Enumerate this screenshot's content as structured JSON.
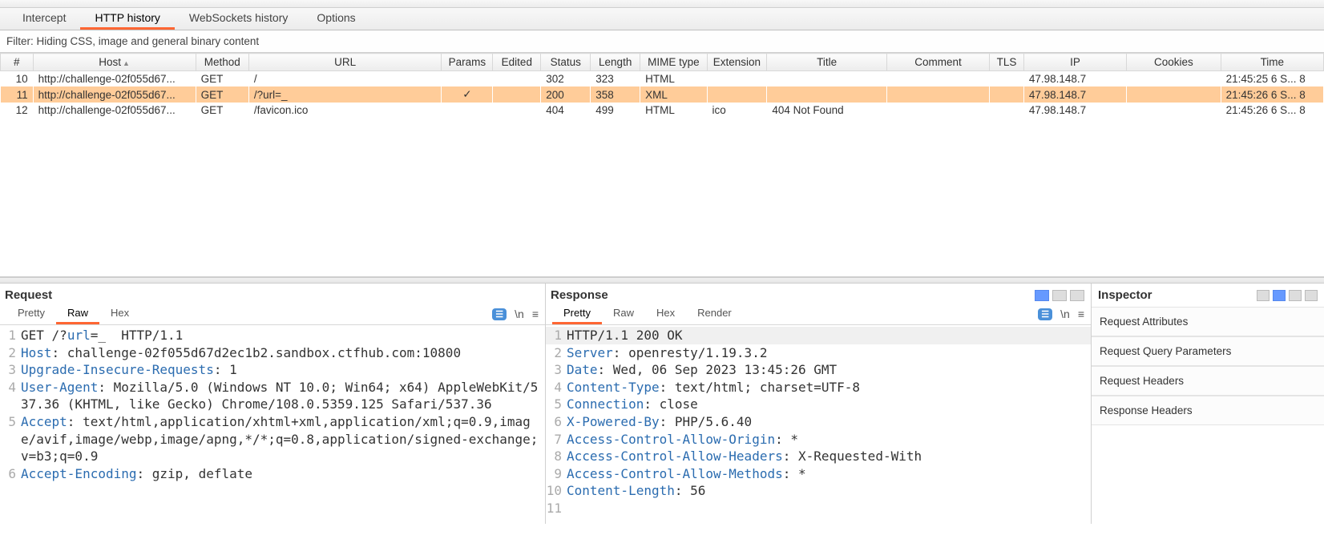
{
  "tabs": {
    "intercept": "Intercept",
    "http": "HTTP history",
    "ws": "WebSockets history",
    "options": "Options",
    "active": "http"
  },
  "filter": "Filter: Hiding CSS, image and general binary content",
  "cols": {
    "num": "#",
    "host": "Host",
    "method": "Method",
    "url": "URL",
    "params": "Params",
    "edited": "Edited",
    "status": "Status",
    "length": "Length",
    "mime": "MIME type",
    "extension": "Extension",
    "title": "Title",
    "comment": "Comment",
    "tls": "TLS",
    "ip": "IP",
    "cookies": "Cookies",
    "time": "Time"
  },
  "rows": [
    {
      "num": "10",
      "host": "http://challenge-02f055d67...",
      "method": "GET",
      "url": "/",
      "params": "",
      "status": "302",
      "length": "323",
      "mime": "HTML",
      "ext": "",
      "title": "",
      "ip": "47.98.148.7",
      "time": "21:45:25 6 S...",
      "selected": false
    },
    {
      "num": "11",
      "host": "http://challenge-02f055d67...",
      "method": "GET",
      "url": "/?url=_",
      "params": "✓",
      "status": "200",
      "length": "358",
      "mime": "XML",
      "ext": "",
      "title": "",
      "ip": "47.98.148.7",
      "time": "21:45:26 6 S...",
      "selected": true
    },
    {
      "num": "12",
      "host": "http://challenge-02f055d67...",
      "method": "GET",
      "url": "/favicon.ico",
      "params": "",
      "status": "404",
      "length": "499",
      "mime": "HTML",
      "ext": "ico",
      "title": "404 Not Found",
      "ip": "47.98.148.7",
      "time": "21:45:26 6 S...",
      "selected": false
    }
  ],
  "row_trail": "8",
  "request_label": "Request",
  "response_label": "Response",
  "inspector_label": "Inspector",
  "req_tabs": {
    "pretty": "Pretty",
    "raw": "Raw",
    "hex": "Hex",
    "active": "raw"
  },
  "res_tabs": {
    "pretty": "Pretty",
    "raw": "Raw",
    "hex": "Hex",
    "render": "Render",
    "active": "pretty"
  },
  "newline_label": "\\n",
  "request_lines": [
    {
      "n": "1",
      "raw": "GET /?url=_  HTTP/1.1",
      "segs": [
        {
          "t": "GET",
          "c": ""
        },
        {
          "t": " /?",
          "c": ""
        },
        {
          "t": "url",
          "c": "hh"
        },
        {
          "t": "=_  HTTP/1.1",
          "c": ""
        }
      ]
    },
    {
      "n": "2",
      "raw": "Host: challenge-02f055d67d2ec1b2.sandbox.ctfhub.com:10800",
      "segs": [
        {
          "t": "Host",
          "c": "hh"
        },
        {
          "t": ": challenge-02f055d67d2ec1b2.sandbox.ctfhub.com:10800",
          "c": ""
        }
      ]
    },
    {
      "n": "3",
      "raw": "Upgrade-Insecure-Requests: 1",
      "segs": [
        {
          "t": "Upgrade-Insecure-Requests",
          "c": "hh"
        },
        {
          "t": ": 1",
          "c": ""
        }
      ]
    },
    {
      "n": "4",
      "raw": "User-Agent: Mozilla/5.0 (Windows NT 10.0; Win64; x64) AppleWebKit/537.36 (KHTML, like Gecko) Chrome/108.0.5359.125 Safari/537.36",
      "segs": [
        {
          "t": "User-Agent",
          "c": "hh"
        },
        {
          "t": ": Mozilla/5.0 (Windows NT 10.0; Win64; x64) AppleWebKit/537.36 (KHTML, like Gecko) Chrome/108.0.5359.125 Safari/537.36",
          "c": ""
        }
      ]
    },
    {
      "n": "5",
      "raw": "Accept: text/html,application/xhtml+xml,application/xml;q=0.9,image/avif,image/webp,image/apng,*/*;q=0.8,application/signed-exchange;v=b3;q=0.9",
      "segs": [
        {
          "t": "Accept",
          "c": "hh"
        },
        {
          "t": ": text/html,application/xhtml+xml,application/xml;q=0.9,image/avif,image/webp,image/apng,*/*;q=0.8,application/signed-exchange;v=b3;q=0.9",
          "c": ""
        }
      ]
    },
    {
      "n": "6",
      "raw": "Accept-Encoding: gzip, deflate",
      "segs": [
        {
          "t": "Accept-Encoding",
          "c": "hh"
        },
        {
          "t": ": gzip, deflate",
          "c": ""
        }
      ]
    }
  ],
  "response_lines": [
    {
      "n": "1",
      "hl": true,
      "segs": [
        {
          "t": "HTTP/1.1 200 OK",
          "c": ""
        }
      ]
    },
    {
      "n": "2",
      "segs": [
        {
          "t": "Server",
          "c": "hh"
        },
        {
          "t": ": openresty/1.19.3.2",
          "c": ""
        }
      ]
    },
    {
      "n": "3",
      "segs": [
        {
          "t": "Date",
          "c": "hh"
        },
        {
          "t": ": Wed, 06 Sep 2023 13:45:26 GMT",
          "c": ""
        }
      ]
    },
    {
      "n": "4",
      "segs": [
        {
          "t": "Content-Type",
          "c": "hh"
        },
        {
          "t": ": text/html; charset=UTF-8",
          "c": ""
        }
      ]
    },
    {
      "n": "5",
      "segs": [
        {
          "t": "Connection",
          "c": "hh"
        },
        {
          "t": ": close",
          "c": ""
        }
      ]
    },
    {
      "n": "6",
      "segs": [
        {
          "t": "X-Powered-By",
          "c": "hh"
        },
        {
          "t": ": PHP/5.6.40",
          "c": ""
        }
      ]
    },
    {
      "n": "7",
      "segs": [
        {
          "t": "Access-Control-Allow-Origin",
          "c": "hh"
        },
        {
          "t": ": *",
          "c": ""
        }
      ]
    },
    {
      "n": "8",
      "segs": [
        {
          "t": "Access-Control-Allow-Headers",
          "c": "hh"
        },
        {
          "t": ": X-Requested-With",
          "c": ""
        }
      ]
    },
    {
      "n": "9",
      "segs": [
        {
          "t": "Access-Control-Allow-Methods",
          "c": "hh"
        },
        {
          "t": ": *",
          "c": ""
        }
      ]
    },
    {
      "n": "10",
      "segs": [
        {
          "t": "Content-Length",
          "c": "hh"
        },
        {
          "t": ": 56",
          "c": ""
        }
      ]
    },
    {
      "n": "11",
      "segs": [
        {
          "t": "",
          "c": ""
        }
      ]
    }
  ],
  "inspector_sections": [
    "Request Attributes",
    "Request Query Parameters",
    "Request Headers",
    "Response Headers"
  ]
}
